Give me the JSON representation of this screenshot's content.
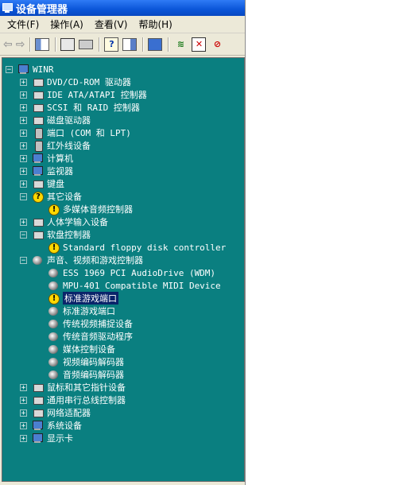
{
  "window": {
    "title": "设备管理器"
  },
  "menu": [
    {
      "label": "文件(F)"
    },
    {
      "label": "操作(A)"
    },
    {
      "label": "查看(V)"
    },
    {
      "label": "帮助(H)"
    }
  ],
  "toolbar": {
    "icons": [
      "back-arrow-icon",
      "forward-arrow-icon",
      "tree-view-icon",
      "properties-icon",
      "print-icon",
      "help-icon",
      "console-icon",
      "scan-hardware-icon",
      "update-driver-icon",
      "uninstall-icon",
      "disable-icon"
    ]
  },
  "tree": {
    "root": "WINR",
    "items": [
      {
        "label": "DVD/CD-ROM 驱动器",
        "level": 1,
        "expander": "+",
        "icon": "cdrom-icon"
      },
      {
        "label": "IDE ATA/ATAPI 控制器",
        "level": 1,
        "expander": "+",
        "icon": "ide-controller-icon"
      },
      {
        "label": "SCSI 和 RAID 控制器",
        "level": 1,
        "expander": "+",
        "icon": "scsi-icon"
      },
      {
        "label": "磁盘驱动器",
        "level": 1,
        "expander": "+",
        "icon": "disk-drive-icon"
      },
      {
        "label": "端口 (COM 和 LPT)",
        "level": 1,
        "expander": "+",
        "icon": "port-icon"
      },
      {
        "label": "红外线设备",
        "level": 1,
        "expander": "+",
        "icon": "infrared-icon"
      },
      {
        "label": "计算机",
        "level": 1,
        "expander": "+",
        "icon": "computer-icon"
      },
      {
        "label": "监视器",
        "level": 1,
        "expander": "+",
        "icon": "monitor-icon"
      },
      {
        "label": "键盘",
        "level": 1,
        "expander": "+",
        "icon": "keyboard-icon"
      },
      {
        "label": "其它设备",
        "level": 1,
        "expander": "−",
        "icon": "unknown-device-icon"
      },
      {
        "label": "多媒体音频控制器",
        "level": 2,
        "expander": "",
        "icon": "warning-icon"
      },
      {
        "label": "人体学输入设备",
        "level": 1,
        "expander": "+",
        "icon": "hid-icon"
      },
      {
        "label": "软盘控制器",
        "level": 1,
        "expander": "−",
        "icon": "floppy-controller-icon"
      },
      {
        "label": "Standard floppy disk controller",
        "level": 2,
        "expander": "",
        "icon": "warning-icon"
      },
      {
        "label": "声音、视频和游戏控制器",
        "level": 1,
        "expander": "−",
        "icon": "sound-icon"
      },
      {
        "label": "ESS 1969 PCI AudioDrive (WDM)",
        "level": 2,
        "expander": "",
        "icon": "speaker-icon"
      },
      {
        "label": "MPU-401 Compatible MIDI Device",
        "level": 2,
        "expander": "",
        "icon": "speaker-icon"
      },
      {
        "label": "标准游戏端口",
        "level": 2,
        "expander": "",
        "icon": "warning-icon",
        "selected": true
      },
      {
        "label": "标准游戏端口",
        "level": 2,
        "expander": "",
        "icon": "speaker-icon"
      },
      {
        "label": "传统视频捕捉设备",
        "level": 2,
        "expander": "",
        "icon": "speaker-icon"
      },
      {
        "label": "传统音频驱动程序",
        "level": 2,
        "expander": "",
        "icon": "speaker-icon"
      },
      {
        "label": "媒体控制设备",
        "level": 2,
        "expander": "",
        "icon": "speaker-icon"
      },
      {
        "label": "视频编码解码器",
        "level": 2,
        "expander": "",
        "icon": "speaker-icon"
      },
      {
        "label": "音频编码解码器",
        "level": 2,
        "expander": "",
        "icon": "speaker-icon"
      },
      {
        "label": "鼠标和其它指针设备",
        "level": 1,
        "expander": "+",
        "icon": "mouse-icon"
      },
      {
        "label": "通用串行总线控制器",
        "level": 1,
        "expander": "+",
        "icon": "usb-icon"
      },
      {
        "label": "网络适配器",
        "level": 1,
        "expander": "+",
        "icon": "network-adapter-icon"
      },
      {
        "label": "系统设备",
        "level": 1,
        "expander": "+",
        "icon": "system-device-icon"
      },
      {
        "label": "显示卡",
        "level": 1,
        "expander": "+",
        "icon": "display-adapter-icon"
      }
    ]
  },
  "colors": {
    "tree_bg": "#0a7f80",
    "title_bg": "#0a55d8",
    "selection": "#0a246a",
    "warning": "#ffd800"
  }
}
